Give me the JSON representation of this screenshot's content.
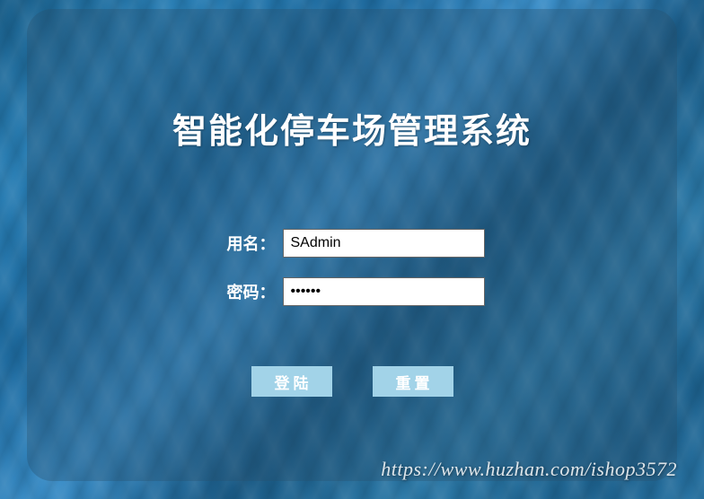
{
  "title": "智能化停车场管理系统",
  "form": {
    "username_label": "用名：",
    "username_value": "SAdmin",
    "password_label": "密码：",
    "password_value": "••••••"
  },
  "buttons": {
    "login": "登陆",
    "reset": "重置"
  },
  "watermark": "https://www.huzhan.com/ishop3572"
}
